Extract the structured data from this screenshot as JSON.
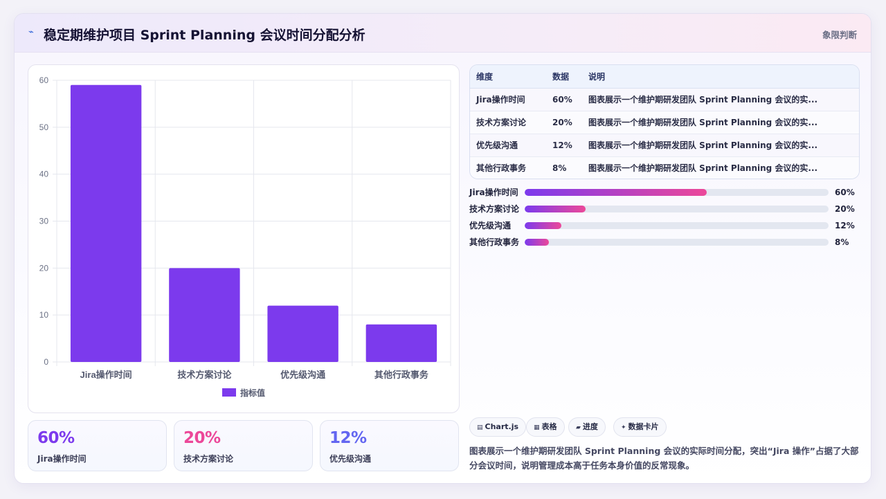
{
  "header": {
    "icon": "trend-icon",
    "title": "稳定期维护项目 Sprint Planning 会议时间分配分析",
    "tag": "象限判断"
  },
  "chart_data": {
    "type": "bar",
    "categories": [
      "Jira操作时间",
      "技术方案讨论",
      "优先级沟通",
      "其他行政事务"
    ],
    "series": [
      {
        "name": "指标值",
        "values": [
          59,
          20,
          12,
          8
        ],
        "color": "#7c3aed"
      }
    ],
    "ylim": [
      0,
      60
    ],
    "yticks": [
      0,
      10,
      20,
      30,
      40,
      50,
      60
    ],
    "grid": true,
    "legend": "bottom"
  },
  "stats": [
    {
      "value": "60%",
      "label": "Jira操作时间",
      "color": "#7c3aed"
    },
    {
      "value": "20%",
      "label": "技术方案讨论",
      "color": "#ec4899"
    },
    {
      "value": "12%",
      "label": "优先级沟通",
      "color": "#6366f1"
    }
  ],
  "table": {
    "headers": [
      "维度",
      "数据",
      "说明"
    ],
    "rows": [
      [
        "Jira操作时间",
        "60%",
        "图表展示一个维护期研发团队 Sprint Planning 会议的实..."
      ],
      [
        "技术方案讨论",
        "20%",
        "图表展示一个维护期研发团队 Sprint Planning 会议的实..."
      ],
      [
        "优先级沟通",
        "12%",
        "图表展示一个维护期研发团队 Sprint Planning 会议的实..."
      ],
      [
        "其他行政事务",
        "8%",
        "图表展示一个维护期研发团队 Sprint Planning 会议的实..."
      ]
    ]
  },
  "progress": [
    {
      "label": "Jira操作时间",
      "value": 0.6,
      "pct": "60%"
    },
    {
      "label": "技术方案讨论",
      "value": 0.2,
      "pct": "20%"
    },
    {
      "label": "优先级沟通",
      "value": 0.12,
      "pct": "12%"
    },
    {
      "label": "其他行政事务",
      "value": 0.08,
      "pct": "8%"
    }
  ],
  "chips": [
    {
      "icon": "▤",
      "label": "Chart.js"
    },
    {
      "icon": "▦",
      "label": "表格"
    },
    {
      "icon": "▰",
      "label": "进度"
    },
    {
      "icon": "✦",
      "label": "数据卡片"
    }
  ],
  "summary": "图表展示一个维护期研发团队 Sprint Planning 会议的实际时间分配，突出“Jira 操作”占据了大部分会议时间，说明管理成本高于任务本身价值的反常现象。"
}
